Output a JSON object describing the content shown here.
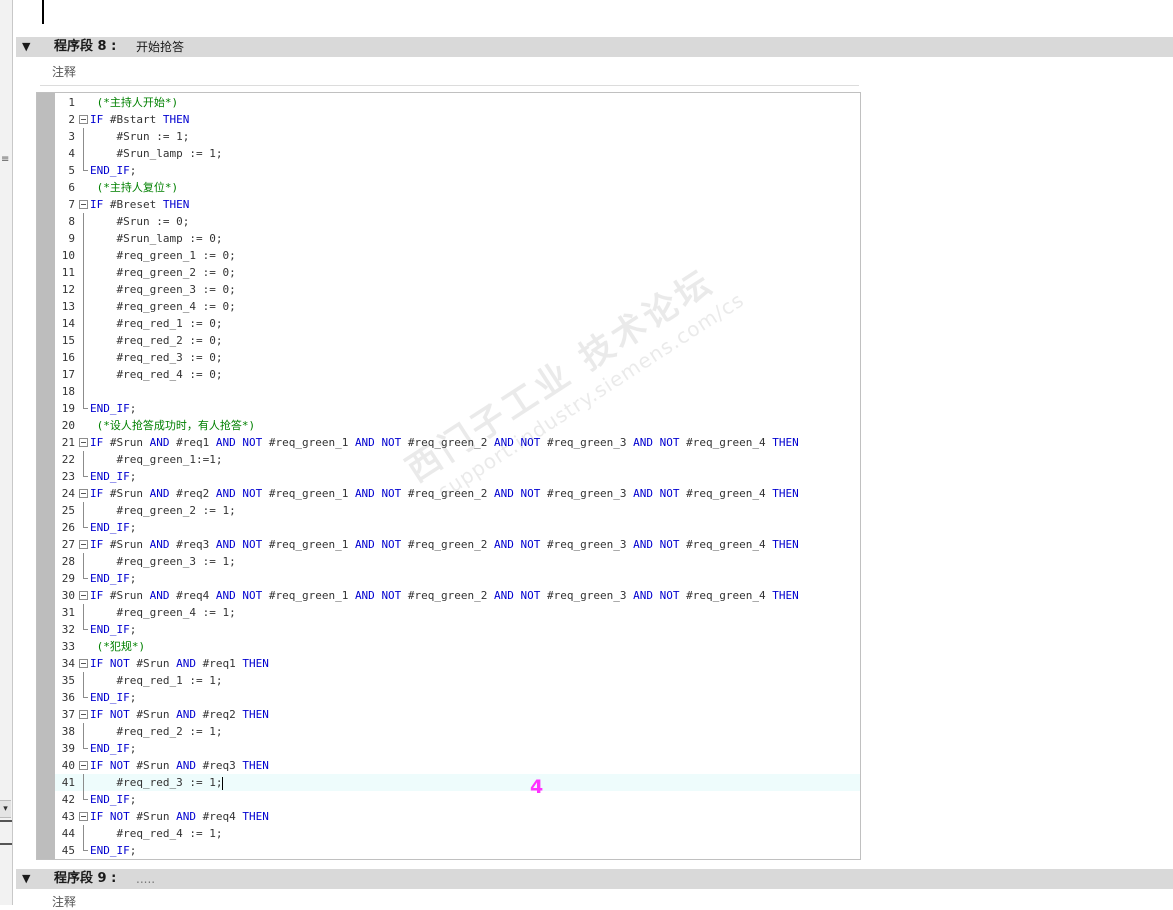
{
  "segment8": {
    "title": "程序段 8 :",
    "name": "开始抢答",
    "comment": "注释",
    "code_lines": [
      {
        "n": "1",
        "code": "(*主持人开始*)",
        "type": "comment"
      },
      {
        "n": "2",
        "code": "IF #Bstart THEN",
        "fold": true
      },
      {
        "n": "3",
        "code": "    #Srun := 1;"
      },
      {
        "n": "4",
        "code": "    #Srun_lamp := 1;"
      },
      {
        "n": "5",
        "code": "END_IF;",
        "end": true
      },
      {
        "n": "6",
        "code": "(*主持人复位*)",
        "type": "comment"
      },
      {
        "n": "7",
        "code": "IF #Breset THEN",
        "fold": true
      },
      {
        "n": "8",
        "code": "    #Srun := 0;"
      },
      {
        "n": "9",
        "code": "    #Srun_lamp := 0;"
      },
      {
        "n": "10",
        "code": "    #req_green_1 := 0;"
      },
      {
        "n": "11",
        "code": "    #req_green_2 := 0;"
      },
      {
        "n": "12",
        "code": "    #req_green_3 := 0;"
      },
      {
        "n": "13",
        "code": "    #req_green_4 := 0;"
      },
      {
        "n": "14",
        "code": "    #req_red_1 := 0;"
      },
      {
        "n": "15",
        "code": "    #req_red_2 := 0;"
      },
      {
        "n": "16",
        "code": "    #req_red_3 := 0;"
      },
      {
        "n": "17",
        "code": "    #req_red_4 := 0;"
      },
      {
        "n": "18",
        "code": ""
      },
      {
        "n": "19",
        "code": "END_IF;",
        "end": true
      },
      {
        "n": "20",
        "code": "(*设人抢答成功时，有人抢答*)",
        "type": "comment"
      },
      {
        "n": "21",
        "code": "IF #Srun AND #req1 AND NOT #req_green_1 AND NOT #req_green_2 AND NOT #req_green_3 AND NOT #req_green_4 THEN",
        "fold": true
      },
      {
        "n": "22",
        "code": "    #req_green_1:=1;"
      },
      {
        "n": "23",
        "code": "END_IF;",
        "end": true
      },
      {
        "n": "24",
        "code": "IF #Srun AND #req2 AND NOT #req_green_1 AND NOT #req_green_2 AND NOT #req_green_3 AND NOT #req_green_4 THEN",
        "fold": true
      },
      {
        "n": "25",
        "code": "    #req_green_2 := 1;"
      },
      {
        "n": "26",
        "code": "END_IF;",
        "end": true
      },
      {
        "n": "27",
        "code": "IF #Srun AND #req3 AND NOT #req_green_1 AND NOT #req_green_2 AND NOT #req_green_3 AND NOT #req_green_4 THEN",
        "fold": true
      },
      {
        "n": "28",
        "code": "    #req_green_3 := 1;"
      },
      {
        "n": "29",
        "code": "END_IF;",
        "end": true
      },
      {
        "n": "30",
        "code": "IF #Srun AND #req4 AND NOT #req_green_1 AND NOT #req_green_2 AND NOT #req_green_3 AND NOT #req_green_4 THEN",
        "fold": true
      },
      {
        "n": "31",
        "code": "    #req_green_4 := 1;"
      },
      {
        "n": "32",
        "code": "END_IF;",
        "end": true
      },
      {
        "n": "33",
        "code": "(*犯规*)",
        "type": "comment"
      },
      {
        "n": "34",
        "code": "IF NOT #Srun AND #req1 THEN",
        "fold": true
      },
      {
        "n": "35",
        "code": "    #req_red_1 := 1;"
      },
      {
        "n": "36",
        "code": "END_IF;",
        "end": true
      },
      {
        "n": "37",
        "code": "IF NOT #Srun AND #req2 THEN",
        "fold": true
      },
      {
        "n": "38",
        "code": "    #req_red_2 := 1;"
      },
      {
        "n": "39",
        "code": "END_IF;",
        "end": true
      },
      {
        "n": "40",
        "code": "IF NOT #Srun AND #req3 THEN",
        "fold": true
      },
      {
        "n": "41",
        "code": "    #req_red_3 := 1;",
        "active": true
      },
      {
        "n": "42",
        "code": "END_IF;",
        "end": true
      },
      {
        "n": "43",
        "code": "IF NOT #Srun AND #req4 THEN",
        "fold": true
      },
      {
        "n": "44",
        "code": "    #req_red_4 := 1;"
      },
      {
        "n": "45",
        "code": "END_IF;",
        "end": true
      }
    ]
  },
  "segment9": {
    "title": "程序段 9 :",
    "name": ".....",
    "comment": "注释"
  },
  "annotation_marker": "4",
  "watermark": {
    "line1": "西门子工业 技术论坛",
    "line2": "support.industry.siemens.com/cs"
  },
  "colors": {
    "keyword": "#0000d0",
    "comment": "#008000",
    "marker": "#ff33ff",
    "segment_bar": "#d9d9d9"
  },
  "icons": {
    "collapse": "triangle-down-icon",
    "fold": "minus-box-icon"
  }
}
